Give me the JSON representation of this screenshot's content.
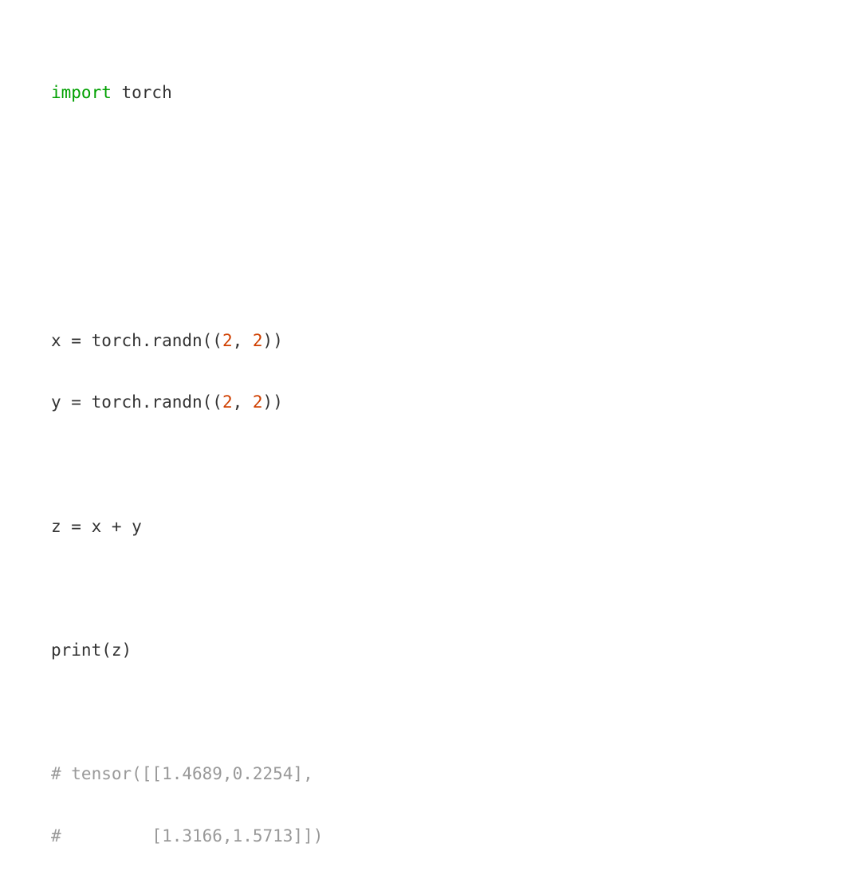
{
  "code": {
    "line1_keyword": "import",
    "line1_rest": " torch",
    "line5_pre": "x = torch.randn((",
    "line5_num1": "2",
    "line5_sep": ", ",
    "line5_num2": "2",
    "line5_post": "))",
    "line6_pre": "y = torch.randn((",
    "line6_num1": "2",
    "line6_sep": ", ",
    "line6_num2": "2",
    "line6_post": "))",
    "line8": "z = x + y",
    "line10": "print(z)",
    "line12_comment": "# tensor([[1.4689,0.2254],",
    "line13_comment": "#         [1.3166,1.5713]])"
  }
}
